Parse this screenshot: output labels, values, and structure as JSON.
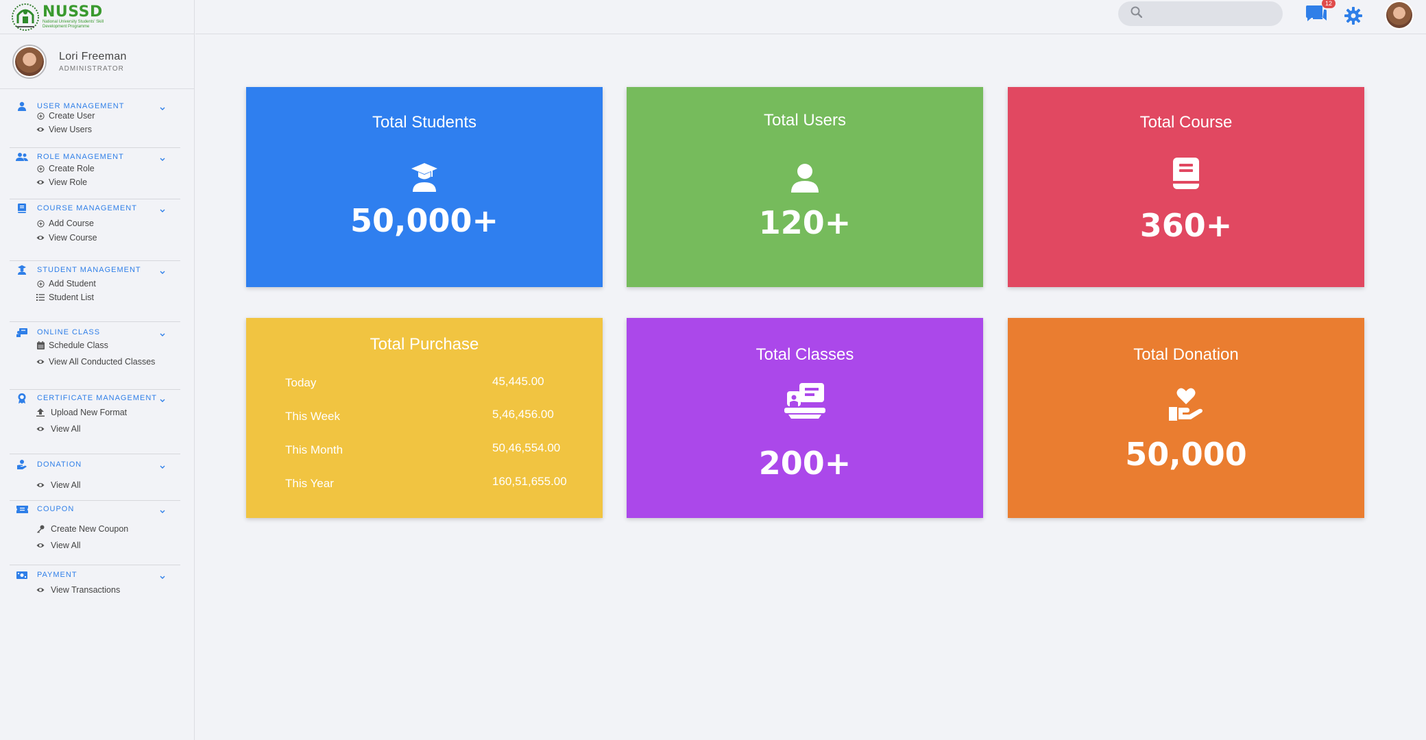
{
  "brand": {
    "title": "NUSSD",
    "subtitle": "National University Students' Skill Development Programme"
  },
  "profile": {
    "name": "Lori Freeman",
    "role": "ADMINISTRATOR"
  },
  "sidebar": {
    "sections": [
      {
        "title": "USER MANAGEMENT",
        "icon": "user-icon",
        "items": [
          {
            "label": "Create User",
            "icon": "plus-circle-icon"
          },
          {
            "label": "View Users",
            "icon": "eye-icon"
          }
        ]
      },
      {
        "title": "ROLE MANAGEMENT",
        "icon": "users-icon",
        "items": [
          {
            "label": "Create Role",
            "icon": "plus-circle-icon"
          },
          {
            "label": "View Role",
            "icon": "eye-icon"
          }
        ]
      },
      {
        "title": "COURSE MANAGEMENT",
        "icon": "book-icon",
        "items": [
          {
            "label": "Add Course",
            "icon": "plus-circle-icon"
          },
          {
            "label": "View Course",
            "icon": "eye-icon"
          }
        ]
      },
      {
        "title": "STUDENT MANAGEMENT",
        "icon": "graduate-icon",
        "items": [
          {
            "label": "Add Student",
            "icon": "plus-circle-icon"
          },
          {
            "label": "Student List",
            "icon": "list-icon"
          }
        ]
      },
      {
        "title": "ONLINE CLASS",
        "icon": "chalkboard-icon",
        "items": [
          {
            "label": "Schedule Class",
            "icon": "calendar-icon"
          },
          {
            "label": "View All Conducted Classes",
            "icon": "eye-icon"
          }
        ]
      },
      {
        "title": "CERTIFICATE MANAGEMENT",
        "icon": "award-icon",
        "items": [
          {
            "label": "Upload New Format",
            "icon": "upload-icon"
          },
          {
            "label": "View All",
            "icon": "eye-icon"
          }
        ]
      },
      {
        "title": "DONATION",
        "icon": "donate-icon",
        "items": [
          {
            "label": "View All",
            "icon": "eye-icon"
          }
        ]
      },
      {
        "title": "COUPON",
        "icon": "ticket-icon",
        "items": [
          {
            "label": "Create New Coupon",
            "icon": "key-icon"
          },
          {
            "label": "View All",
            "icon": "eye-icon"
          }
        ]
      },
      {
        "title": "PAYMENT",
        "icon": "money-icon",
        "items": [
          {
            "label": "View Transactions",
            "icon": "eye-icon"
          }
        ]
      }
    ]
  },
  "topbar": {
    "search_placeholder": "",
    "notification_count": "12"
  },
  "cards": {
    "students": {
      "title": "Total Students",
      "value": "50,000+",
      "color": "#2f7fef"
    },
    "users": {
      "title": "Total Users",
      "value": "120+",
      "color": "#76bb5c"
    },
    "course": {
      "title": "Total Course",
      "value": "360+",
      "color": "#e14861"
    },
    "purchase": {
      "title": "Total Purchase",
      "color": "#f1c441",
      "rows": [
        {
          "label": "Today",
          "value": "45,445.00"
        },
        {
          "label": "This Week",
          "value": "5,46,456.00"
        },
        {
          "label": "This Month",
          "value": "50,46,554.00"
        },
        {
          "label": "This Year",
          "value": "160,51,655.00"
        }
      ]
    },
    "classes": {
      "title": "Total Classes",
      "value": "200+",
      "color": "#ab48ea"
    },
    "donation": {
      "title": "Total Donation",
      "value": "50,000",
      "color": "#ea7d30"
    }
  }
}
